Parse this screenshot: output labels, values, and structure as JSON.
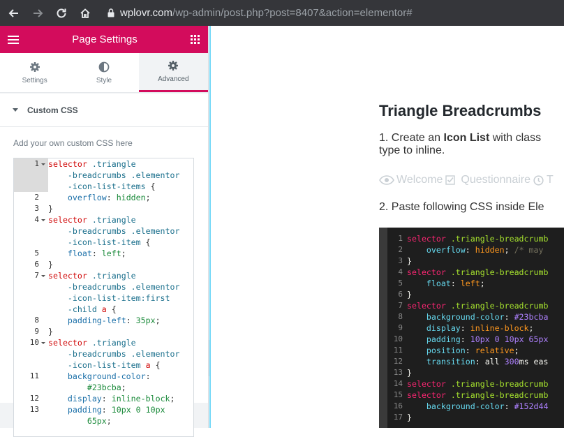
{
  "browser": {
    "url_host": "wplovr.com",
    "url_path": "/wp-admin/post.php?post=8407&action=elementor#"
  },
  "panel": {
    "title": "Page Settings",
    "tabs": [
      {
        "label": "Settings",
        "icon": "gear-icon"
      },
      {
        "label": "Style",
        "icon": "half-circle-icon"
      },
      {
        "label": "Advanced",
        "icon": "gear-icon"
      }
    ],
    "section_title": "Custom CSS",
    "description": "Add your own custom CSS here"
  },
  "editor": {
    "rows": [
      {
        "ln": "1",
        "fold": true,
        "active": true,
        "html": "<span class='k-sel'>selector</span> <span class='k-cls'>.triangle</span>"
      },
      {
        "ln": "",
        "active": true,
        "html": "    <span class='k-cls'>-breadcrumbs .elementor</span>"
      },
      {
        "ln": "",
        "active": true,
        "html": "    <span class='k-cls'>-icon-list-items</span> {"
      },
      {
        "ln": "2",
        "html": "    <span class='k-prop'>overflow</span>: <span class='k-val'>hidden</span>;"
      },
      {
        "ln": "3",
        "html": "}"
      },
      {
        "ln": "4",
        "fold": true,
        "html": "<span class='k-sel'>selector</span> <span class='k-cls'>.triangle</span>"
      },
      {
        "ln": "",
        "html": "    <span class='k-cls'>-breadcrumbs .elementor</span>"
      },
      {
        "ln": "",
        "html": "    <span class='k-cls'>-icon-list-item</span> {"
      },
      {
        "ln": "5",
        "html": "    <span class='k-prop'>float</span>: <span class='k-val'>left</span>;"
      },
      {
        "ln": "6",
        "html": "}"
      },
      {
        "ln": "7",
        "fold": true,
        "html": "<span class='k-sel'>selector</span> <span class='k-cls'>.triangle</span>"
      },
      {
        "ln": "",
        "html": "    <span class='k-cls'>-breadcrumbs .elementor</span>"
      },
      {
        "ln": "",
        "html": "    <span class='k-cls'>-icon-list-item:first</span>"
      },
      {
        "ln": "",
        "html": "    <span class='k-cls'>-child</span> <span class='k-sel'>a</span> {"
      },
      {
        "ln": "8",
        "html": "    <span class='k-prop'>padding-left</span>: <span class='k-num'>35px</span>;"
      },
      {
        "ln": "9",
        "html": "}"
      },
      {
        "ln": "10",
        "fold": true,
        "html": "<span class='k-sel'>selector</span> <span class='k-cls'>.triangle</span>"
      },
      {
        "ln": "",
        "html": "    <span class='k-cls'>-breadcrumbs .elementor</span>"
      },
      {
        "ln": "",
        "html": "    <span class='k-cls'>-icon-list-item</span> <span class='k-sel'>a</span> {"
      },
      {
        "ln": "11",
        "html": "    <span class='k-prop'>background-color</span>:"
      },
      {
        "ln": "",
        "html": "        <span class='k-num'>#23bcba</span>;"
      },
      {
        "ln": "12",
        "html": "    <span class='k-prop'>display</span>: <span class='k-val'>inline-block</span>;"
      },
      {
        "ln": "13",
        "html": "    <span class='k-prop'>padding</span>: <span class='k-num'>10px 0 10px</span>"
      },
      {
        "ln": "",
        "html": "        <span class='k-num'>65px</span>;"
      }
    ]
  },
  "preview": {
    "heading": "Triangle Breadcrumbs",
    "step1_prefix": "1. Create an ",
    "step1_bold": "Icon List",
    "step1_suffix": " with class",
    "step1_line2": "type to inline.",
    "crumbs": [
      "Welcome",
      "Questionnaire"
    ],
    "step2": "2. Paste following CSS inside Ele"
  },
  "dark_code": {
    "rows": [
      {
        "ln": "1",
        "html": "<span class='d-sel'>selector</span> <span class='d-cls'>.triangle-breadcrumb</span>"
      },
      {
        "ln": "2",
        "html": "    <span class='d-prop'>overflow</span>: <span class='d-val'>hidden</span>; <span class='d-com'>/* may</span>"
      },
      {
        "ln": "3",
        "html": "}"
      },
      {
        "ln": "4",
        "html": "<span class='d-sel'>selector</span> <span class='d-cls'>.triangle-breadcrumb</span>"
      },
      {
        "ln": "5",
        "html": "    <span class='d-prop'>float</span>: <span class='d-val'>left</span>;"
      },
      {
        "ln": "6",
        "html": "}"
      },
      {
        "ln": "7",
        "html": "<span class='d-sel'>selector</span> <span class='d-cls'>.triangle-breadcrumb</span>"
      },
      {
        "ln": "8",
        "html": "    <span class='d-prop'>background-color</span>: <span class='d-num'>#23bcba</span>"
      },
      {
        "ln": "9",
        "html": "    <span class='d-prop'>display</span>: <span class='d-val'>inline-block</span>;"
      },
      {
        "ln": "10",
        "html": "    <span class='d-prop'>padding</span>: <span class='d-num'>10px 0 10px 65px</span>"
      },
      {
        "ln": "11",
        "html": "    <span class='d-prop'>position</span>: <span class='d-val'>relative</span>;"
      },
      {
        "ln": "12",
        "html": "    <span class='d-prop'>transition</span>: <span class='d-wht'>all</span> <span class='d-num'>300</span><span class='d-wht'>ms eas</span>"
      },
      {
        "ln": "13",
        "html": "}"
      },
      {
        "ln": "14",
        "html": "<span class='d-sel'>selector</span> <span class='d-cls'>.triangle-breadcrumb</span>"
      },
      {
        "ln": "15",
        "html": "<span class='d-sel'>selector</span> <span class='d-cls'>.triangle-breadcrumb</span>"
      },
      {
        "ln": "16",
        "html": "    <span class='d-prop'>background-color</span>: <span class='d-num'>#152d44</span>"
      },
      {
        "ln": "17",
        "html": "}"
      }
    ]
  }
}
